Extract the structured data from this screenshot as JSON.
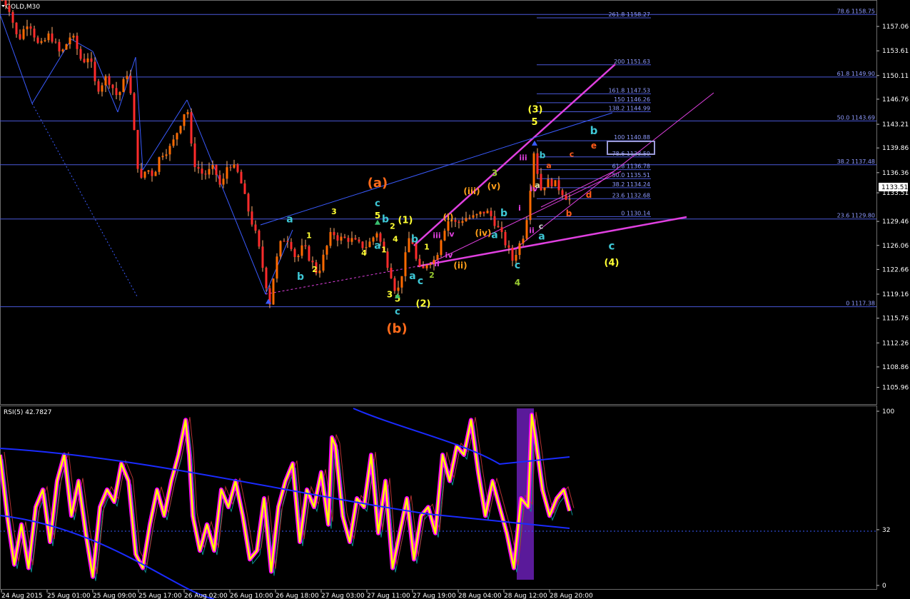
{
  "header": {
    "symbol": "GOLD,M30",
    "indicator": "RSI(5) 42.7827"
  },
  "colors": {
    "background": "#000000",
    "grid": "#1a1a1a",
    "fib": "#4a58d8",
    "fib_text": "#8f9bff",
    "bull": "#ff6a00",
    "bear": "#ff2b2b",
    "wedge": "#e040e0",
    "blue_line": "#3a5bff",
    "rsi_main": "#ffff00",
    "rsi_glow": "#ff00ff",
    "rsi_ma": "#1a2bff",
    "highlight": "#5a1a9a"
  },
  "chart_data": [
    {
      "type": "candlestick",
      "title": "GOLD,M30",
      "ylim": [
        1103.8,
        1160.6
      ],
      "y_ticks": [
        "1157.06",
        "1153.61",
        "1150.11",
        "1146.76",
        "1143.21",
        "1139.86",
        "1136.36",
        "1133.51",
        "1129.46",
        "1126.06",
        "1122.66",
        "1119.16",
        "1115.76",
        "1112.26",
        "1108.86",
        "1105.96"
      ],
      "current_price": "1133.51",
      "x_ticks": [
        "24 Aug 2015",
        "25 Aug 01:00",
        "25 Aug 09:00",
        "25 Aug 17:00",
        "26 Aug 02:00",
        "26 Aug 10:00",
        "26 Aug 18:00",
        "27 Aug 03:00",
        "27 Aug 11:00",
        "27 Aug 19:00",
        "28 Aug 04:00",
        "28 Aug 12:00",
        "28 Aug 20:00"
      ],
      "price_path": [
        [
          0,
          1161
        ],
        [
          12,
          1160
        ],
        [
          25,
          1155
        ],
        [
          40,
          1158
        ],
        [
          55,
          1154
        ],
        [
          70,
          1156
        ],
        [
          85,
          1153
        ],
        [
          100,
          1156
        ],
        [
          115,
          1152
        ],
        [
          125,
          1153
        ],
        [
          135,
          1148
        ],
        [
          150,
          1150
        ],
        [
          165,
          1147
        ],
        [
          180,
          1151
        ],
        [
          185,
          1145
        ],
        [
          192,
          1138
        ],
        [
          197,
          1135
        ],
        [
          205,
          1137
        ],
        [
          215,
          1136
        ],
        [
          225,
          1139
        ],
        [
          240,
          1140
        ],
        [
          255,
          1144
        ],
        [
          262,
          1146
        ],
        [
          270,
          1138
        ],
        [
          285,
          1136
        ],
        [
          300,
          1137
        ],
        [
          310,
          1134
        ],
        [
          320,
          1138
        ],
        [
          335,
          1136
        ],
        [
          345,
          1132
        ],
        [
          360,
          1127
        ],
        [
          370,
          1122
        ],
        [
          378,
          1118
        ],
        [
          385,
          1123
        ],
        [
          395,
          1127
        ],
        [
          405,
          1127
        ],
        [
          415,
          1124
        ],
        [
          425,
          1126
        ],
        [
          435,
          1124
        ],
        [
          445,
          1122
        ],
        [
          455,
          1125
        ],
        [
          465,
          1128
        ],
        [
          475,
          1127
        ],
        [
          490,
          1127
        ],
        [
          505,
          1126
        ],
        [
          515,
          1126
        ],
        [
          528,
          1128
        ],
        [
          538,
          1125
        ],
        [
          548,
          1122
        ],
        [
          556,
          1119
        ],
        [
          565,
          1123
        ],
        [
          575,
          1128
        ],
        [
          583,
          1124
        ],
        [
          590,
          1122
        ],
        [
          600,
          1124
        ],
        [
          610,
          1124
        ],
        [
          620,
          1128
        ],
        [
          630,
          1130
        ],
        [
          640,
          1129
        ],
        [
          650,
          1130
        ],
        [
          665,
          1130
        ],
        [
          680,
          1131
        ],
        [
          690,
          1130
        ],
        [
          700,
          1128
        ],
        [
          710,
          1126
        ],
        [
          718,
          1124
        ],
        [
          727,
          1126
        ],
        [
          735,
          1128
        ],
        [
          742,
          1133
        ],
        [
          747,
          1140
        ],
        [
          752,
          1137
        ],
        [
          758,
          1134
        ],
        [
          765,
          1135
        ],
        [
          775,
          1135
        ],
        [
          785,
          1134
        ],
        [
          793,
          1133
        ],
        [
          798,
          1132.5
        ]
      ],
      "fib_levels": [
        {
          "label": "78.6 1158.75",
          "price": 1158.75,
          "span": "full"
        },
        {
          "label": "61.8 1149.90",
          "price": 1149.9,
          "span": "full"
        },
        {
          "label": "50.0 1143.69",
          "price": 1143.69,
          "span": "full"
        },
        {
          "label": "38.2 1137.48",
          "price": 1137.48,
          "span": "full"
        },
        {
          "label": "23.6 1129.80",
          "price": 1129.8,
          "span": "full"
        },
        {
          "label": "0 1117.38",
          "price": 1117.38,
          "span": "full"
        },
        {
          "label": "261.8 1158.27",
          "price": 1158.27,
          "span": "short"
        },
        {
          "label": "200 1151.63",
          "price": 1151.63,
          "span": "short"
        },
        {
          "label": "161.8 1147.53",
          "price": 1147.53,
          "span": "short"
        },
        {
          "label": "150 1146.26",
          "price": 1146.26,
          "span": "short"
        },
        {
          "label": "138.2 1144.99",
          "price": 1144.99,
          "span": "short"
        },
        {
          "label": "100 1140.88",
          "price": 1140.88,
          "span": "short"
        },
        {
          "label": "78.6 1138.59",
          "price": 1138.59,
          "span": "short"
        },
        {
          "label": "61.8 1136.78",
          "price": 1136.78,
          "span": "short"
        },
        {
          "label": "50.0 1135.51",
          "price": 1135.51,
          "span": "short"
        },
        {
          "label": "38.2 1134.24",
          "price": 1134.24,
          "span": "short"
        },
        {
          "label": "23.6 1132.68",
          "price": 1132.68,
          "span": "short"
        },
        {
          "label": "0 1130.14",
          "price": 1130.14,
          "span": "short"
        }
      ],
      "wave_labels": [
        {
          "text": "(a)",
          "x": 529,
          "price": 1134.3,
          "color": "#ff6a1a",
          "size": 18
        },
        {
          "text": "c",
          "x": 529,
          "price": 1131.6,
          "color": "#3ec8d6",
          "size": 13
        },
        {
          "text": "5",
          "x": 529,
          "price": 1129.9,
          "color": "#ffff33",
          "size": 12
        },
        {
          "text": "(b)",
          "x": 556,
          "price": 1113.7,
          "color": "#ff6a1a",
          "size": 18
        },
        {
          "text": "c",
          "x": 557,
          "price": 1116.3,
          "color": "#3ec8d6",
          "size": 13
        },
        {
          "text": "5",
          "x": 557,
          "price": 1118.1,
          "color": "#ffff33",
          "size": 12
        },
        {
          "text": "3",
          "x": 546,
          "price": 1118.7,
          "color": "#ffff33",
          "size": 12
        },
        {
          "text": "a",
          "x": 406,
          "price": 1129.3,
          "color": "#3ec8d6",
          "size": 14
        },
        {
          "text": "b",
          "x": 421,
          "price": 1121.2,
          "color": "#3ec8d6",
          "size": 14
        },
        {
          "text": "1",
          "x": 433,
          "price": 1127.1,
          "color": "#ffff33",
          "size": 11
        },
        {
          "text": "2",
          "x": 441,
          "price": 1122.3,
          "color": "#ffff33",
          "size": 11
        },
        {
          "text": "3",
          "x": 468,
          "price": 1130.5,
          "color": "#ffff33",
          "size": 11
        },
        {
          "text": "4",
          "x": 510,
          "price": 1124.6,
          "color": "#ffff33",
          "size": 11
        },
        {
          "text": "b",
          "x": 540,
          "price": 1129.3,
          "color": "#3ec8d6",
          "size": 14
        },
        {
          "text": "2",
          "x": 550,
          "price": 1128.4,
          "color": "#ffff33",
          "size": 11
        },
        {
          "text": "a",
          "x": 529,
          "price": 1125.6,
          "color": "#3ec8d6",
          "size": 14
        },
        {
          "text": "1",
          "x": 538,
          "price": 1125.1,
          "color": "#ffff33",
          "size": 11
        },
        {
          "text": "4",
          "x": 554,
          "price": 1126.6,
          "color": "#ffff33",
          "size": 11
        },
        {
          "text": "(1)",
          "x": 568,
          "price": 1129.2,
          "color": "#ffff33",
          "size": 13
        },
        {
          "text": "b",
          "x": 581,
          "price": 1126.5,
          "color": "#3ec8d6",
          "size": 14
        },
        {
          "text": "a",
          "x": 578,
          "price": 1121.3,
          "color": "#3ec8d6",
          "size": 14
        },
        {
          "text": "c",
          "x": 589,
          "price": 1120.6,
          "color": "#3ec8d6",
          "size": 14
        },
        {
          "text": "2",
          "x": 605,
          "price": 1121.5,
          "color": "#9acd32",
          "size": 11
        },
        {
          "text": "1",
          "x": 598,
          "price": 1125.5,
          "color": "#ffff33",
          "size": 11
        },
        {
          "text": "(2)",
          "x": 593,
          "price": 1117.4,
          "color": "#ffff33",
          "size": 13
        },
        {
          "text": "(i)",
          "x": 628,
          "price": 1129.6,
          "color": "#ff9f1a",
          "size": 12
        },
        {
          "text": "(ii)",
          "x": 645,
          "price": 1122.8,
          "color": "#ff9f1a",
          "size": 12
        },
        {
          "text": "(iii)",
          "x": 661,
          "price": 1133.3,
          "color": "#ff9f1a",
          "size": 12
        },
        {
          "text": "(iv)",
          "x": 677,
          "price": 1127.4,
          "color": "#ff9f1a",
          "size": 12
        },
        {
          "text": "(v)",
          "x": 692,
          "price": 1134.0,
          "color": "#ff9f1a",
          "size": 12
        },
        {
          "text": "a",
          "x": 693,
          "price": 1127.1,
          "color": "#3ec8d6",
          "size": 14
        },
        {
          "text": "b",
          "x": 706,
          "price": 1130.2,
          "color": "#3ec8d6",
          "size": 14
        },
        {
          "text": "3",
          "x": 693,
          "price": 1135.9,
          "color": "#9acd32",
          "size": 12
        },
        {
          "text": "iii",
          "x": 612,
          "price": 1127.1,
          "color": "#e040e0",
          "size": 11
        },
        {
          "text": "v",
          "x": 633,
          "price": 1127.3,
          "color": "#e040e0",
          "size": 11
        },
        {
          "text": "iv",
          "x": 629,
          "price": 1124.3,
          "color": "#e040e0",
          "size": 11
        },
        {
          "text": "ii",
          "x": 612,
          "price": 1123.1,
          "color": "#e040e0",
          "size": 11
        },
        {
          "text": "c",
          "x": 725,
          "price": 1122.8,
          "color": "#3ec8d6",
          "size": 14
        },
        {
          "text": "4",
          "x": 725,
          "price": 1120.4,
          "color": "#9acd32",
          "size": 12
        },
        {
          "text": "(3)",
          "x": 750,
          "price": 1144.9,
          "color": "#ffff33",
          "size": 13
        },
        {
          "text": "5",
          "x": 749,
          "price": 1143.1,
          "color": "#ffff33",
          "size": 13
        },
        {
          "text": "iii",
          "x": 733,
          "price": 1138.1,
          "color": "#e040e0",
          "size": 11
        },
        {
          "text": "iv",
          "x": 748,
          "price": 1133.7,
          "color": "#e040e0",
          "size": 11
        },
        {
          "text": "i",
          "x": 728,
          "price": 1131.0,
          "color": "#e040e0",
          "size": 11
        },
        {
          "text": "ii",
          "x": 745,
          "price": 1127.8,
          "color": "#e040e0",
          "size": 11
        },
        {
          "text": "a",
          "x": 759,
          "price": 1126.9,
          "color": "#3ec8d6",
          "size": 14
        },
        {
          "text": "c",
          "x": 758,
          "price": 1128.4,
          "color": "#cfcfcf",
          "size": 11
        },
        {
          "text": "b",
          "x": 760,
          "price": 1138.4,
          "color": "#3ec8d6",
          "size": 12
        },
        {
          "text": "a",
          "x": 753,
          "price": 1134.2,
          "color": "#e8e8a0",
          "size": 11
        },
        {
          "text": "a",
          "x": 769,
          "price": 1137.0,
          "color": "#ff5a1a",
          "size": 11
        },
        {
          "text": "c",
          "x": 801,
          "price": 1138.6,
          "color": "#ff5a1a",
          "size": 11
        },
        {
          "text": "e",
          "x": 832,
          "price": 1139.8,
          "color": "#ff5a1a",
          "size": 12
        },
        {
          "text": "d",
          "x": 825,
          "price": 1132.8,
          "color": "#ff5a1a",
          "size": 12
        },
        {
          "text": "b",
          "x": 797,
          "price": 1130.2,
          "color": "#ff5a1a",
          "size": 12
        },
        {
          "text": "b",
          "x": 832,
          "price": 1141.8,
          "color": "#3ec8d6",
          "size": 15
        },
        {
          "text": "c",
          "x": 857,
          "price": 1125.5,
          "color": "#3ec8d6",
          "size": 15
        },
        {
          "text": "(4)",
          "x": 857,
          "price": 1123.2,
          "color": "#ffff33",
          "size": 13
        }
      ]
    },
    {
      "type": "line",
      "title": "RSI(5) 42.7827",
      "ylim": [
        0,
        100
      ],
      "y_ticks": [
        "100",
        "32",
        "0"
      ],
      "level": 32,
      "rsi_path": [
        [
          0,
          75
        ],
        [
          10,
          40
        ],
        [
          20,
          12
        ],
        [
          30,
          35
        ],
        [
          40,
          10
        ],
        [
          50,
          45
        ],
        [
          60,
          55
        ],
        [
          70,
          25
        ],
        [
          80,
          60
        ],
        [
          90,
          75
        ],
        [
          100,
          40
        ],
        [
          110,
          60
        ],
        [
          120,
          30
        ],
        [
          130,
          5
        ],
        [
          140,
          45
        ],
        [
          150,
          55
        ],
        [
          160,
          48
        ],
        [
          170,
          70
        ],
        [
          180,
          60
        ],
        [
          190,
          18
        ],
        [
          200,
          10
        ],
        [
          210,
          35
        ],
        [
          220,
          55
        ],
        [
          230,
          40
        ],
        [
          240,
          60
        ],
        [
          250,
          75
        ],
        [
          260,
          95
        ],
        [
          265,
          75
        ],
        [
          270,
          40
        ],
        [
          280,
          20
        ],
        [
          290,
          35
        ],
        [
          300,
          20
        ],
        [
          310,
          55
        ],
        [
          320,
          45
        ],
        [
          330,
          60
        ],
        [
          340,
          40
        ],
        [
          350,
          15
        ],
        [
          360,
          20
        ],
        [
          370,
          50
        ],
        [
          380,
          8
        ],
        [
          390,
          45
        ],
        [
          400,
          60
        ],
        [
          410,
          70
        ],
        [
          420,
          25
        ],
        [
          430,
          55
        ],
        [
          440,
          45
        ],
        [
          450,
          65
        ],
        [
          460,
          35
        ],
        [
          465,
          85
        ],
        [
          470,
          80
        ],
        [
          480,
          40
        ],
        [
          490,
          25
        ],
        [
          500,
          50
        ],
        [
          510,
          45
        ],
        [
          520,
          75
        ],
        [
          530,
          30
        ],
        [
          540,
          60
        ],
        [
          550,
          10
        ],
        [
          560,
          30
        ],
        [
          570,
          50
        ],
        [
          580,
          15
        ],
        [
          590,
          40
        ],
        [
          600,
          45
        ],
        [
          610,
          30
        ],
        [
          620,
          75
        ],
        [
          630,
          60
        ],
        [
          640,
          80
        ],
        [
          650,
          75
        ],
        [
          660,
          95
        ],
        [
          670,
          65
        ],
        [
          680,
          40
        ],
        [
          690,
          60
        ],
        [
          700,
          45
        ],
        [
          710,
          30
        ],
        [
          720,
          10
        ],
        [
          730,
          50
        ],
        [
          740,
          45
        ],
        [
          745,
          98
        ],
        [
          750,
          85
        ],
        [
          760,
          55
        ],
        [
          770,
          40
        ],
        [
          780,
          50
        ],
        [
          790,
          55
        ],
        [
          798,
          42.8
        ]
      ]
    }
  ]
}
